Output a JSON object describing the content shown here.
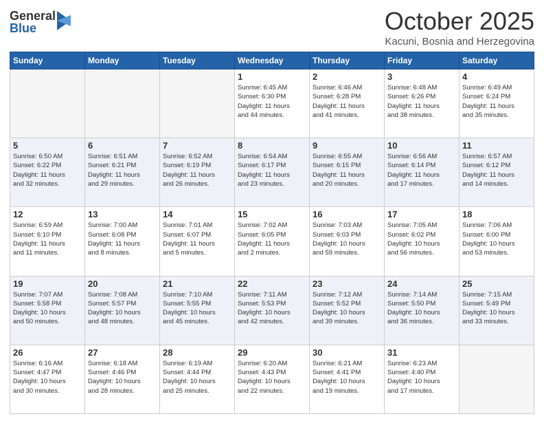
{
  "logo": {
    "general": "General",
    "blue": "Blue"
  },
  "header": {
    "month": "October 2025",
    "location": "Kacuni, Bosnia and Herzegovina"
  },
  "weekdays": [
    "Sunday",
    "Monday",
    "Tuesday",
    "Wednesday",
    "Thursday",
    "Friday",
    "Saturday"
  ],
  "weeks": [
    [
      {
        "day": "",
        "info": ""
      },
      {
        "day": "",
        "info": ""
      },
      {
        "day": "",
        "info": ""
      },
      {
        "day": "1",
        "info": "Sunrise: 6:45 AM\nSunset: 6:30 PM\nDaylight: 11 hours\nand 44 minutes."
      },
      {
        "day": "2",
        "info": "Sunrise: 6:46 AM\nSunset: 6:28 PM\nDaylight: 11 hours\nand 41 minutes."
      },
      {
        "day": "3",
        "info": "Sunrise: 6:48 AM\nSunset: 6:26 PM\nDaylight: 11 hours\nand 38 minutes."
      },
      {
        "day": "4",
        "info": "Sunrise: 6:49 AM\nSunset: 6:24 PM\nDaylight: 11 hours\nand 35 minutes."
      }
    ],
    [
      {
        "day": "5",
        "info": "Sunrise: 6:50 AM\nSunset: 6:22 PM\nDaylight: 11 hours\nand 32 minutes."
      },
      {
        "day": "6",
        "info": "Sunrise: 6:51 AM\nSunset: 6:21 PM\nDaylight: 11 hours\nand 29 minutes."
      },
      {
        "day": "7",
        "info": "Sunrise: 6:52 AM\nSunset: 6:19 PM\nDaylight: 11 hours\nand 26 minutes."
      },
      {
        "day": "8",
        "info": "Sunrise: 6:54 AM\nSunset: 6:17 PM\nDaylight: 11 hours\nand 23 minutes."
      },
      {
        "day": "9",
        "info": "Sunrise: 6:55 AM\nSunset: 6:15 PM\nDaylight: 11 hours\nand 20 minutes."
      },
      {
        "day": "10",
        "info": "Sunrise: 6:56 AM\nSunset: 6:14 PM\nDaylight: 11 hours\nand 17 minutes."
      },
      {
        "day": "11",
        "info": "Sunrise: 6:57 AM\nSunset: 6:12 PM\nDaylight: 11 hours\nand 14 minutes."
      }
    ],
    [
      {
        "day": "12",
        "info": "Sunrise: 6:59 AM\nSunset: 6:10 PM\nDaylight: 11 hours\nand 11 minutes."
      },
      {
        "day": "13",
        "info": "Sunrise: 7:00 AM\nSunset: 6:08 PM\nDaylight: 11 hours\nand 8 minutes."
      },
      {
        "day": "14",
        "info": "Sunrise: 7:01 AM\nSunset: 6:07 PM\nDaylight: 11 hours\nand 5 minutes."
      },
      {
        "day": "15",
        "info": "Sunrise: 7:02 AM\nSunset: 6:05 PM\nDaylight: 11 hours\nand 2 minutes."
      },
      {
        "day": "16",
        "info": "Sunrise: 7:03 AM\nSunset: 6:03 PM\nDaylight: 10 hours\nand 59 minutes."
      },
      {
        "day": "17",
        "info": "Sunrise: 7:05 AM\nSunset: 6:02 PM\nDaylight: 10 hours\nand 56 minutes."
      },
      {
        "day": "18",
        "info": "Sunrise: 7:06 AM\nSunset: 6:00 PM\nDaylight: 10 hours\nand 53 minutes."
      }
    ],
    [
      {
        "day": "19",
        "info": "Sunrise: 7:07 AM\nSunset: 5:58 PM\nDaylight: 10 hours\nand 50 minutes."
      },
      {
        "day": "20",
        "info": "Sunrise: 7:08 AM\nSunset: 5:57 PM\nDaylight: 10 hours\nand 48 minutes."
      },
      {
        "day": "21",
        "info": "Sunrise: 7:10 AM\nSunset: 5:55 PM\nDaylight: 10 hours\nand 45 minutes."
      },
      {
        "day": "22",
        "info": "Sunrise: 7:11 AM\nSunset: 5:53 PM\nDaylight: 10 hours\nand 42 minutes."
      },
      {
        "day": "23",
        "info": "Sunrise: 7:12 AM\nSunset: 5:52 PM\nDaylight: 10 hours\nand 39 minutes."
      },
      {
        "day": "24",
        "info": "Sunrise: 7:14 AM\nSunset: 5:50 PM\nDaylight: 10 hours\nand 36 minutes."
      },
      {
        "day": "25",
        "info": "Sunrise: 7:15 AM\nSunset: 5:49 PM\nDaylight: 10 hours\nand 33 minutes."
      }
    ],
    [
      {
        "day": "26",
        "info": "Sunrise: 6:16 AM\nSunset: 4:47 PM\nDaylight: 10 hours\nand 30 minutes."
      },
      {
        "day": "27",
        "info": "Sunrise: 6:18 AM\nSunset: 4:46 PM\nDaylight: 10 hours\nand 28 minutes."
      },
      {
        "day": "28",
        "info": "Sunrise: 6:19 AM\nSunset: 4:44 PM\nDaylight: 10 hours\nand 25 minutes."
      },
      {
        "day": "29",
        "info": "Sunrise: 6:20 AM\nSunset: 4:43 PM\nDaylight: 10 hours\nand 22 minutes."
      },
      {
        "day": "30",
        "info": "Sunrise: 6:21 AM\nSunset: 4:41 PM\nDaylight: 10 hours\nand 19 minutes."
      },
      {
        "day": "31",
        "info": "Sunrise: 6:23 AM\nSunset: 4:40 PM\nDaylight: 10 hours\nand 17 minutes."
      },
      {
        "day": "",
        "info": ""
      }
    ]
  ]
}
